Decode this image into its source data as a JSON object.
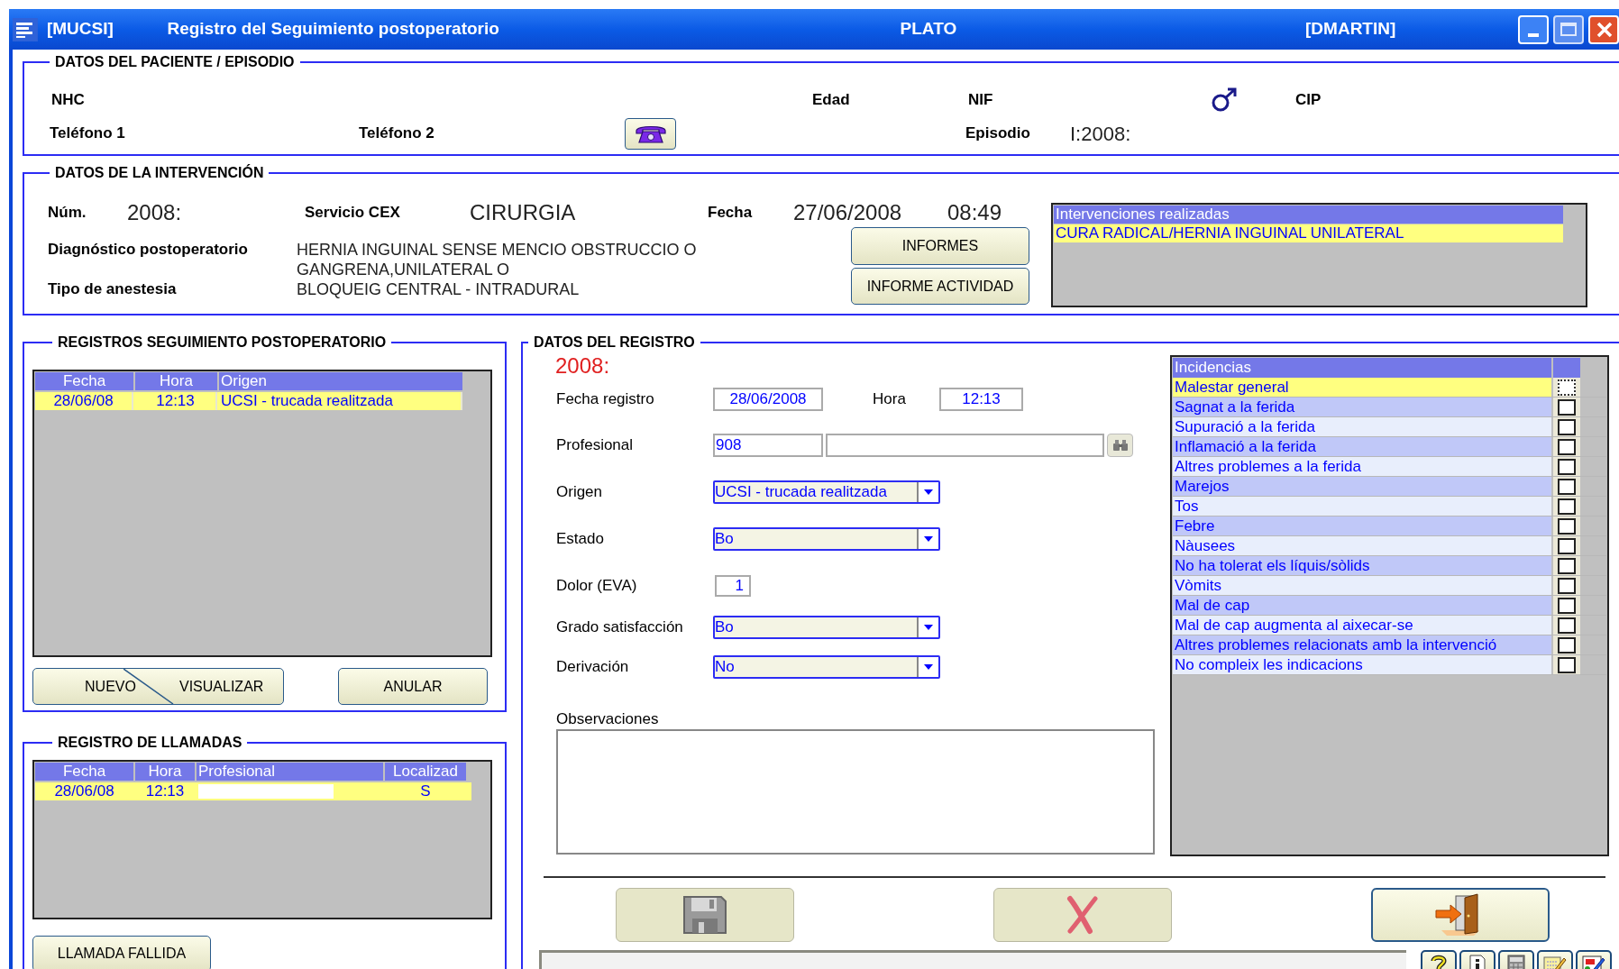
{
  "window": {
    "app_code": "[MUCSI]",
    "title": "Registro del Seguimiento postoperatorio",
    "system": "PLATO",
    "user": "[DMARTIN]"
  },
  "patient": {
    "title": "DATOS DEL PACIENTE / EPISODIO",
    "nhc_label": "NHC",
    "edad_label": "Edad",
    "nif_label": "NIF",
    "male": true,
    "cip_label": "CIP",
    "telefono1_label": "Teléfono 1",
    "telefono2_label": "Teléfono 2",
    "episodio_label": "Episodio",
    "episodio_value": "I:2008:"
  },
  "intervention": {
    "title": "DATOS DE LA INTERVENCIÓN",
    "num_label": "Núm.",
    "num_value": "2008:",
    "servicio_label": "Servicio CEX",
    "servicio_value": "CIRURGIA",
    "fecha_label": "Fecha",
    "fecha_value": "27/06/2008",
    "hora_value": "08:49",
    "diagnostico_label": "Diagnóstico postoperatorio",
    "diagnostico_value": "HERNIA INGUINAL SENSE MENCIO OBSTRUCCIO O GANGRENA,UNILATERAL O",
    "anestesia_label": "Tipo de anestesia",
    "anestesia_value": "BLOQUEIG CENTRAL - INTRADURAL",
    "buttons": [
      "INFORMES",
      "INFORME ACTIVIDAD"
    ],
    "list": {
      "header": "Intervenciones realizadas",
      "rows": [
        {
          "text": "CURA RADICAL/HERNIA INGUINAL UNILATERAL",
          "selected": true
        }
      ]
    }
  },
  "registros": {
    "title": "REGISTROS SEGUIMIENTO POSTOPERATORIO",
    "columns": [
      "Fecha",
      "Hora",
      "Origen"
    ],
    "rows": [
      {
        "cells": [
          "28/06/08",
          "12:13",
          "UCSI - trucada realitzada"
        ],
        "selected": true
      }
    ],
    "split_button": [
      "NUEVO",
      "VISUALIZAR"
    ],
    "anular_button": "ANULAR"
  },
  "llamadas": {
    "title": "REGISTRO DE LLAMADAS",
    "columns": [
      "Fecha",
      "Hora",
      "Profesional",
      "Localizad"
    ],
    "rows": [
      {
        "fecha": "28/06/08",
        "hora": "12:13",
        "profesional_redacted": true,
        "localizado": "S",
        "selected": true
      }
    ],
    "button": "LLAMADA FALLIDA"
  },
  "registro": {
    "title": "DATOS DEL REGISTRO",
    "number": "2008:",
    "fields": [
      {
        "kind": "date_time",
        "label": "Fecha registro",
        "value": "28/06/2008",
        "label2": "Hora",
        "value2": "12:13"
      },
      {
        "kind": "lookup",
        "label": "Profesional",
        "value": "908"
      },
      {
        "kind": "select",
        "label": "Origen",
        "value": "UCSI - trucada realitzada"
      },
      {
        "kind": "select",
        "label": "Estado",
        "value": "Bo"
      },
      {
        "kind": "number",
        "label": "Dolor (EVA)",
        "value": "1"
      },
      {
        "kind": "select",
        "label": "Grado satisfacción",
        "value": "Bo"
      },
      {
        "kind": "select",
        "label": "Derivación",
        "value": "No"
      }
    ],
    "observaciones_label": "Observaciones"
  },
  "incidencias": {
    "header": "Incidencias",
    "items": [
      {
        "label": "Malestar general",
        "checked": false,
        "selected": true
      },
      {
        "label": "Sagnat a la ferida",
        "checked": false,
        "selected": false
      },
      {
        "label": "Supuració a la ferida",
        "checked": false,
        "selected": false
      },
      {
        "label": "Inflamació a la ferida",
        "checked": false,
        "selected": false
      },
      {
        "label": "Altres problemes a la ferida",
        "checked": false,
        "selected": false
      },
      {
        "label": "Marejos",
        "checked": false,
        "selected": false
      },
      {
        "label": "Tos",
        "checked": false,
        "selected": false
      },
      {
        "label": "Febre",
        "checked": false,
        "selected": false
      },
      {
        "label": "Nàusees",
        "checked": false,
        "selected": false
      },
      {
        "label": "No ha tolerat els líquis/sòlids",
        "checked": false,
        "selected": false
      },
      {
        "label": "Vòmits",
        "checked": false,
        "selected": false
      },
      {
        "label": "Mal de cap",
        "checked": false,
        "selected": false
      },
      {
        "label": "Mal de cap augmenta al aixecar-se",
        "checked": false,
        "selected": false
      },
      {
        "label": "Altres problemes relacionats amb la intervenció",
        "checked": false,
        "selected": false
      },
      {
        "label": "No compleix les indicacions",
        "checked": false,
        "selected": false
      }
    ]
  },
  "actions": [
    {
      "kind": "save",
      "disabled": true
    },
    {
      "kind": "cancel",
      "disabled": true
    },
    {
      "kind": "exit",
      "disabled": false
    }
  ],
  "toolbar": [
    {
      "kind": "help"
    },
    {
      "kind": "info"
    },
    {
      "kind": "calculator"
    },
    {
      "kind": "notes"
    },
    {
      "kind": "edit"
    }
  ]
}
